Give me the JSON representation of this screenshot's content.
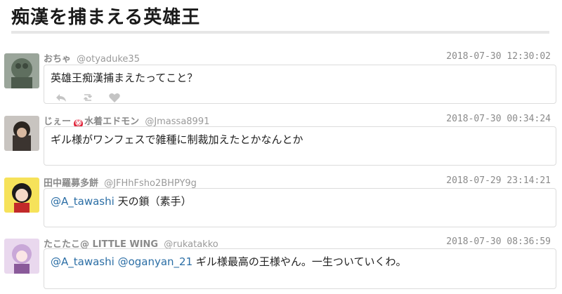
{
  "page": {
    "title": "痴漢を捕まえる英雄王"
  },
  "colors": {
    "mention": "#2b6ea5",
    "meta_gray": "#8a8a8a",
    "border": "#dcdcdc"
  },
  "tweets": [
    {
      "name": "おちゃ",
      "handle": "@otyaduke35",
      "time": "2018-07-30 12:30:02",
      "text": "英雄王痴漢捕まえたってこと？",
      "actions": [
        "reply-icon",
        "retweet-icon",
        "heart-icon"
      ]
    },
    {
      "name": "じぇー",
      "name_badge": "㊙",
      "name_extra": "水着エドモン",
      "handle": "@Jmassa8991",
      "time": "2018-07-30 00:34:24",
      "text": "ギル様がワンフェスで雑種に制裁加えたとかなんとか"
    },
    {
      "name": "田中羅募多餅",
      "handle": "@JFHhFsho2BHPY9g",
      "time": "2018-07-29 23:14:21",
      "mention1": "@A_tawashi",
      "text": "天の鎖（素手）"
    },
    {
      "name": "たこたこ@ LITTLE WING",
      "handle": "@rukatakko",
      "time": "2018-07-30 08:36:59",
      "mention1": "@A_tawashi",
      "mention2": "@oganyan_21",
      "text": "ギル様最高の王様やん。一生ついていくわ。"
    }
  ]
}
